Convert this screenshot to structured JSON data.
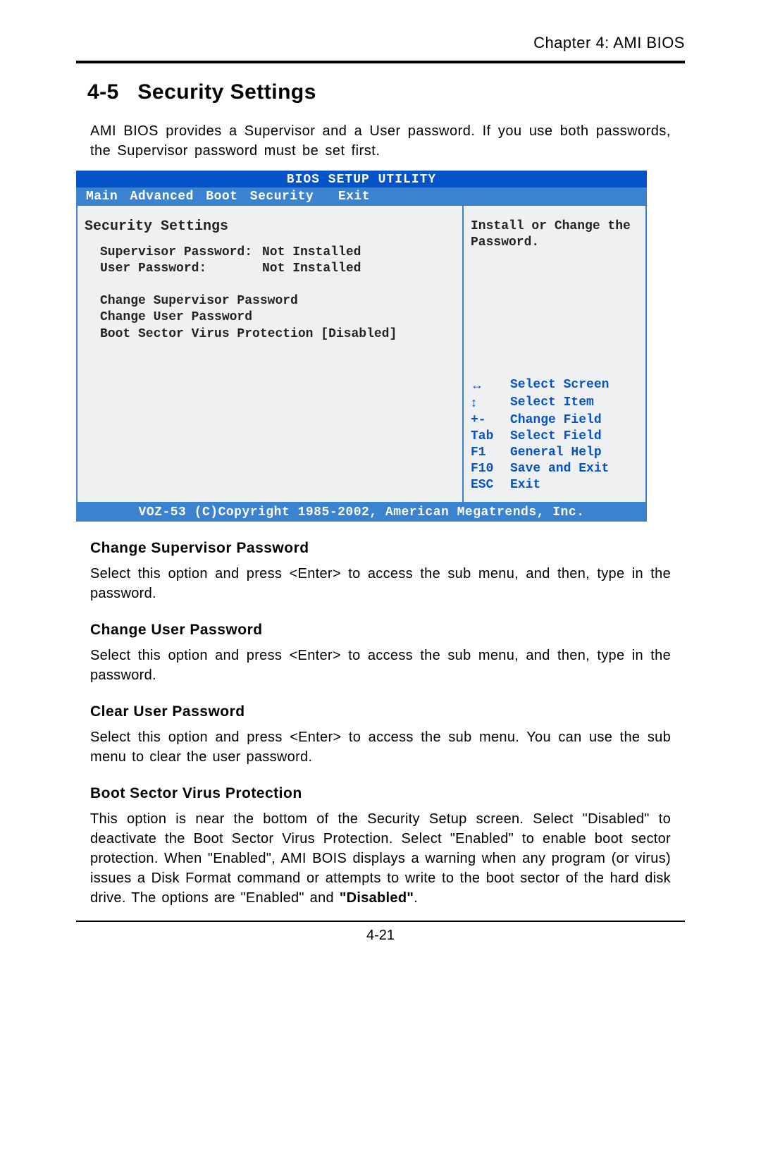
{
  "header": {
    "chapter": "Chapter 4: AMI BIOS"
  },
  "section": {
    "number": "4-5",
    "title": "Security Settings"
  },
  "intro": "AMI BIOS provides a Supervisor and a User password. If you use both passwords, the Supervisor password must be set first.",
  "bios": {
    "title": "BIOS SETUP UTILITY",
    "menu": [
      "Main",
      "Advanced",
      "Boot",
      "Security",
      "Exit"
    ],
    "panel_heading": "Security Settings",
    "fields": {
      "supervisor_label": "Supervisor Password:",
      "supervisor_value": "Not Installed",
      "user_label": "User Password:",
      "user_value": "Not Installed"
    },
    "items": {
      "change_supervisor": "Change Supervisor Password",
      "change_user": "Change User Password",
      "boot_sector_label": "Boot Sector Virus Protection",
      "boot_sector_value": "[Disabled]"
    },
    "help": "Install or Change the Password.",
    "nav": {
      "select_screen": "Select Screen",
      "select_item": "Select Item",
      "change_field_key": "+-",
      "change_field": "Change Field",
      "select_field_key": "Tab",
      "select_field": "Select Field",
      "help_key": "F1",
      "help": "General Help",
      "save_key": "F10",
      "save": "Save and Exit",
      "exit_key": "ESC",
      "exit": "Exit"
    },
    "footer": "VOZ-53 (C)Copyright 1985-2002, American Megatrends, Inc."
  },
  "sections": {
    "s1_title": "Change Supervisor Password",
    "s1_body": "Select this option and press <Enter> to access the sub menu, and then, type in the password.",
    "s2_title": "Change User Password",
    "s2_body": "Select this option and press <Enter> to access the sub menu, and then, type in the password.",
    "s3_title": "Clear User Password",
    "s3_body": "Select  this option and press <Enter> to access the sub menu. You can use the sub menu to clear the user password.",
    "s4_title": "Boot Sector Virus Protection",
    "s4_body_pre": "This option is near the bottom of the Security Setup screen. Select \"Disabled\"  to deactivate the Boot Sector Virus Protection. Select \"Enabled\" to enable boot sector protection. When \"Enabled\", AMI BOIS displays a warning when any program (or virus) issues a Disk Format command or attempts to write to the boot sector of the hard disk drive.  The options are \"Enabled\" and ",
    "s4_body_bold": "\"Disabled\"",
    "s4_body_post": "."
  },
  "page_number": "4-21"
}
